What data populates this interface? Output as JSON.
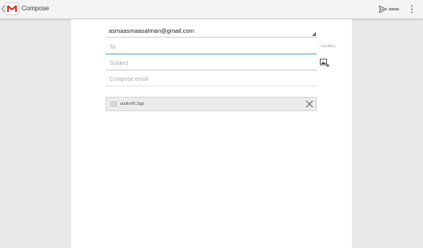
{
  "actionbar": {
    "title": "Compose",
    "send_label": "SEND"
  },
  "compose": {
    "from_account": "asmaasmaasalman@gmail.com",
    "to_placeholder": "To",
    "subject_placeholder": "Subject",
    "body_placeholder": "Compose email",
    "ccbcc_label": "+ CC/BCC"
  },
  "attachment": {
    "filename": "audio66.3gp"
  },
  "colors": {
    "brand_red": "#d93025",
    "focus_blue": "#4aa3c7"
  },
  "icons": {
    "up": "up-caret-icon",
    "logo": "gmail-logo-icon",
    "send": "send-icon",
    "overflow": "overflow-menu-icon",
    "attach": "attach-picture-icon",
    "attachment_type": "audio-file-icon",
    "remove": "close-icon"
  }
}
